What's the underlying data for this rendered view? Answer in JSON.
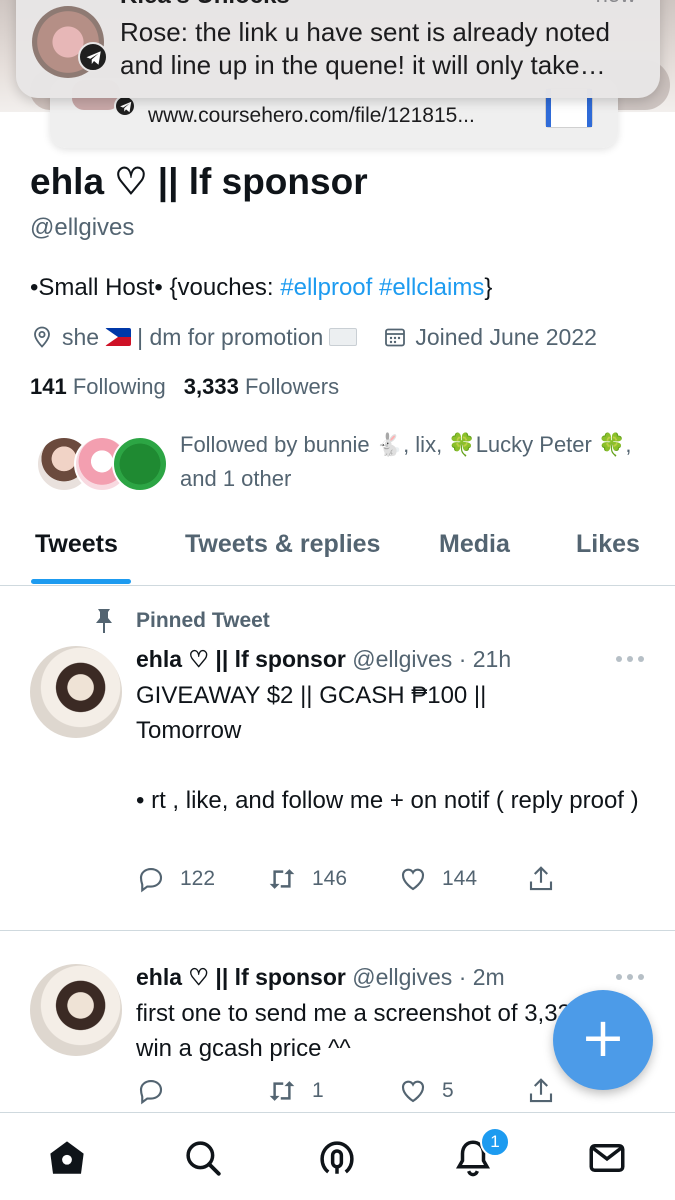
{
  "notifications": {
    "front": {
      "title": "Klea's Unlocks",
      "time": "now",
      "message": "Rose: the link u have sent is alreadу noted and line up in the quene! it will only take…"
    },
    "back": {
      "link": "www.coursehero.com/file/121815..."
    }
  },
  "profile": {
    "name": "ehla ♡ || lf sponsor",
    "handle": "@ellgives",
    "bio_prefix": "•Small Host• {vouches: ",
    "bio_tag1": "#ellproof",
    "bio_tag2": "#ellclaims",
    "bio_suffix": "}",
    "pronoun": "she",
    "promo": "| dm for promotion",
    "joined": "Joined June 2022",
    "following_count": "141",
    "following_label": "Following",
    "followers_count": "3,333",
    "followers_label": "Followers",
    "followed_by": "Followed by bunnie 🐇, lix, 🍀Lucky Peter 🍀, and 1 other"
  },
  "tabs": [
    "Tweets",
    "Tweets & replies",
    "Media",
    "Likes"
  ],
  "pinned_label": "Pinned Tweet",
  "tweets": [
    {
      "name": "ehla ♡ || lf sponsor",
      "meta": "@ellgives · 21h",
      "text": "GIVEAWAY $2 || GCASH ₱100 ||\nTomorrow\n\n• rt , like, and follow me + on notif ( reply proof )",
      "replies": "122",
      "retweets": "146",
      "likes": "144"
    },
    {
      "name": "ehla ♡ || lf sponsor",
      "meta": "@ellgives · 2m",
      "text": "first one to send me a screenshot of 3,333ff will win a gcash price ^^",
      "replies": "",
      "retweets": "1",
      "likes": "5"
    }
  ],
  "fab": {
    "label": "+"
  },
  "bottom_nav": {
    "notification_badge": "1"
  },
  "colors": {
    "accent": "#1d9bf0",
    "text": "#0f1419",
    "muted": "#536471",
    "fab": "#4c9be8"
  },
  "icons": [
    "telegram-icon",
    "location-icon",
    "calendar-icon",
    "pin-icon",
    "more-icon",
    "reply-icon",
    "retweet-icon",
    "like-icon",
    "share-icon",
    "home-icon",
    "search-icon",
    "spaces-icon",
    "notifications-icon",
    "messages-icon"
  ]
}
